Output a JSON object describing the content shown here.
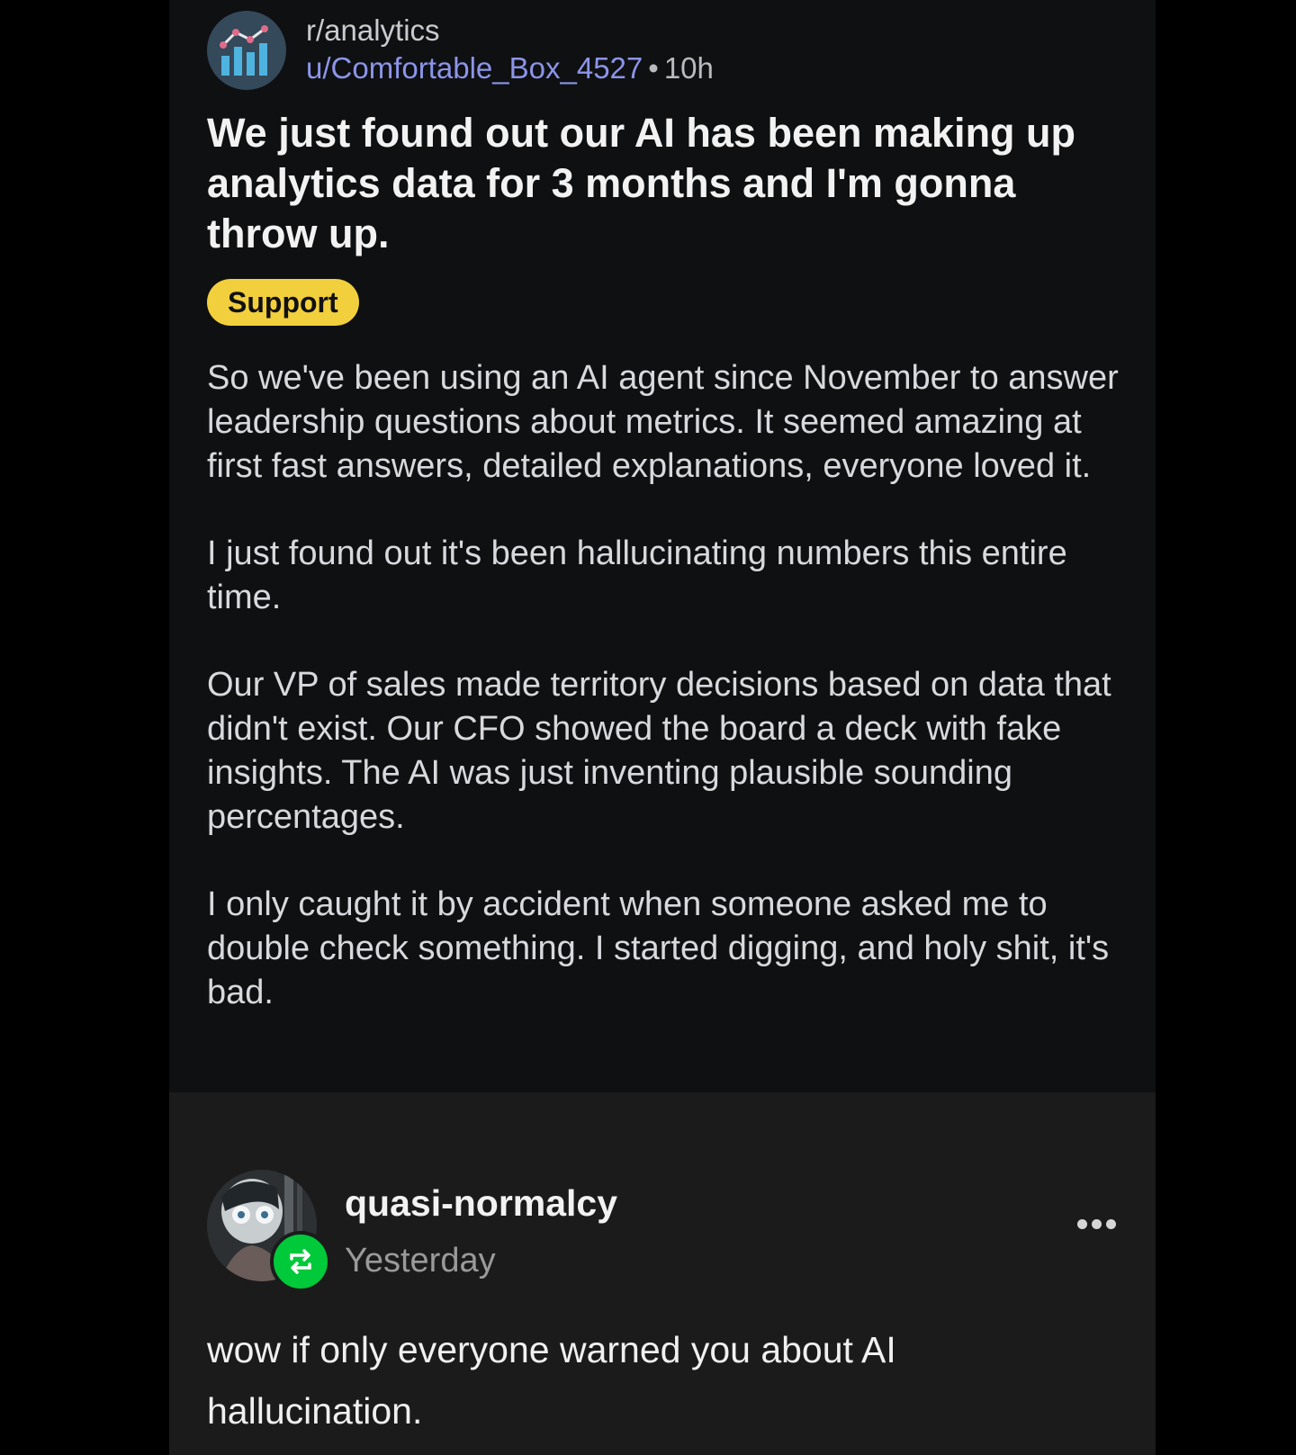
{
  "reddit_post": {
    "subreddit": "r/analytics",
    "username": "u/Comfortable_Box_4527",
    "separator": "•",
    "age": "10h",
    "title": "We just found out our AI has been making up analytics data for 3 months and I'm gonna throw up.",
    "flair": "Support",
    "paragraphs": [
      "So we've been using an AI agent since November to answer leadership questions about metrics. It seemed amazing at first fast answers, detailed explanations, everyone loved it.",
      "I just found out it's been hallucinating numbers this entire time.",
      "Our VP of sales made territory decisions based on data that didn't exist. Our CFO showed the board a deck with fake insights. The AI was just inventing plausible sounding percentages.",
      "I only caught it by accident when someone asked me to double check something. I started digging, and holy shit, it's bad."
    ],
    "avatar_icon": "bar-chart-icon"
  },
  "reply": {
    "blog_name": "quasi-normalcy",
    "timestamp": "Yesterday",
    "text": "wow if only everyone warned you about AI hallucination.",
    "reblog_icon": "reblog-icon",
    "more_icon": "more-dots-icon"
  },
  "colors": {
    "background": "#000000",
    "reddit_card": "#0f1012",
    "reply_area": "#1b1b1b",
    "username": "#8c95e8",
    "flair": "#f2cf3d",
    "reblog_badge": "#00c93a"
  }
}
